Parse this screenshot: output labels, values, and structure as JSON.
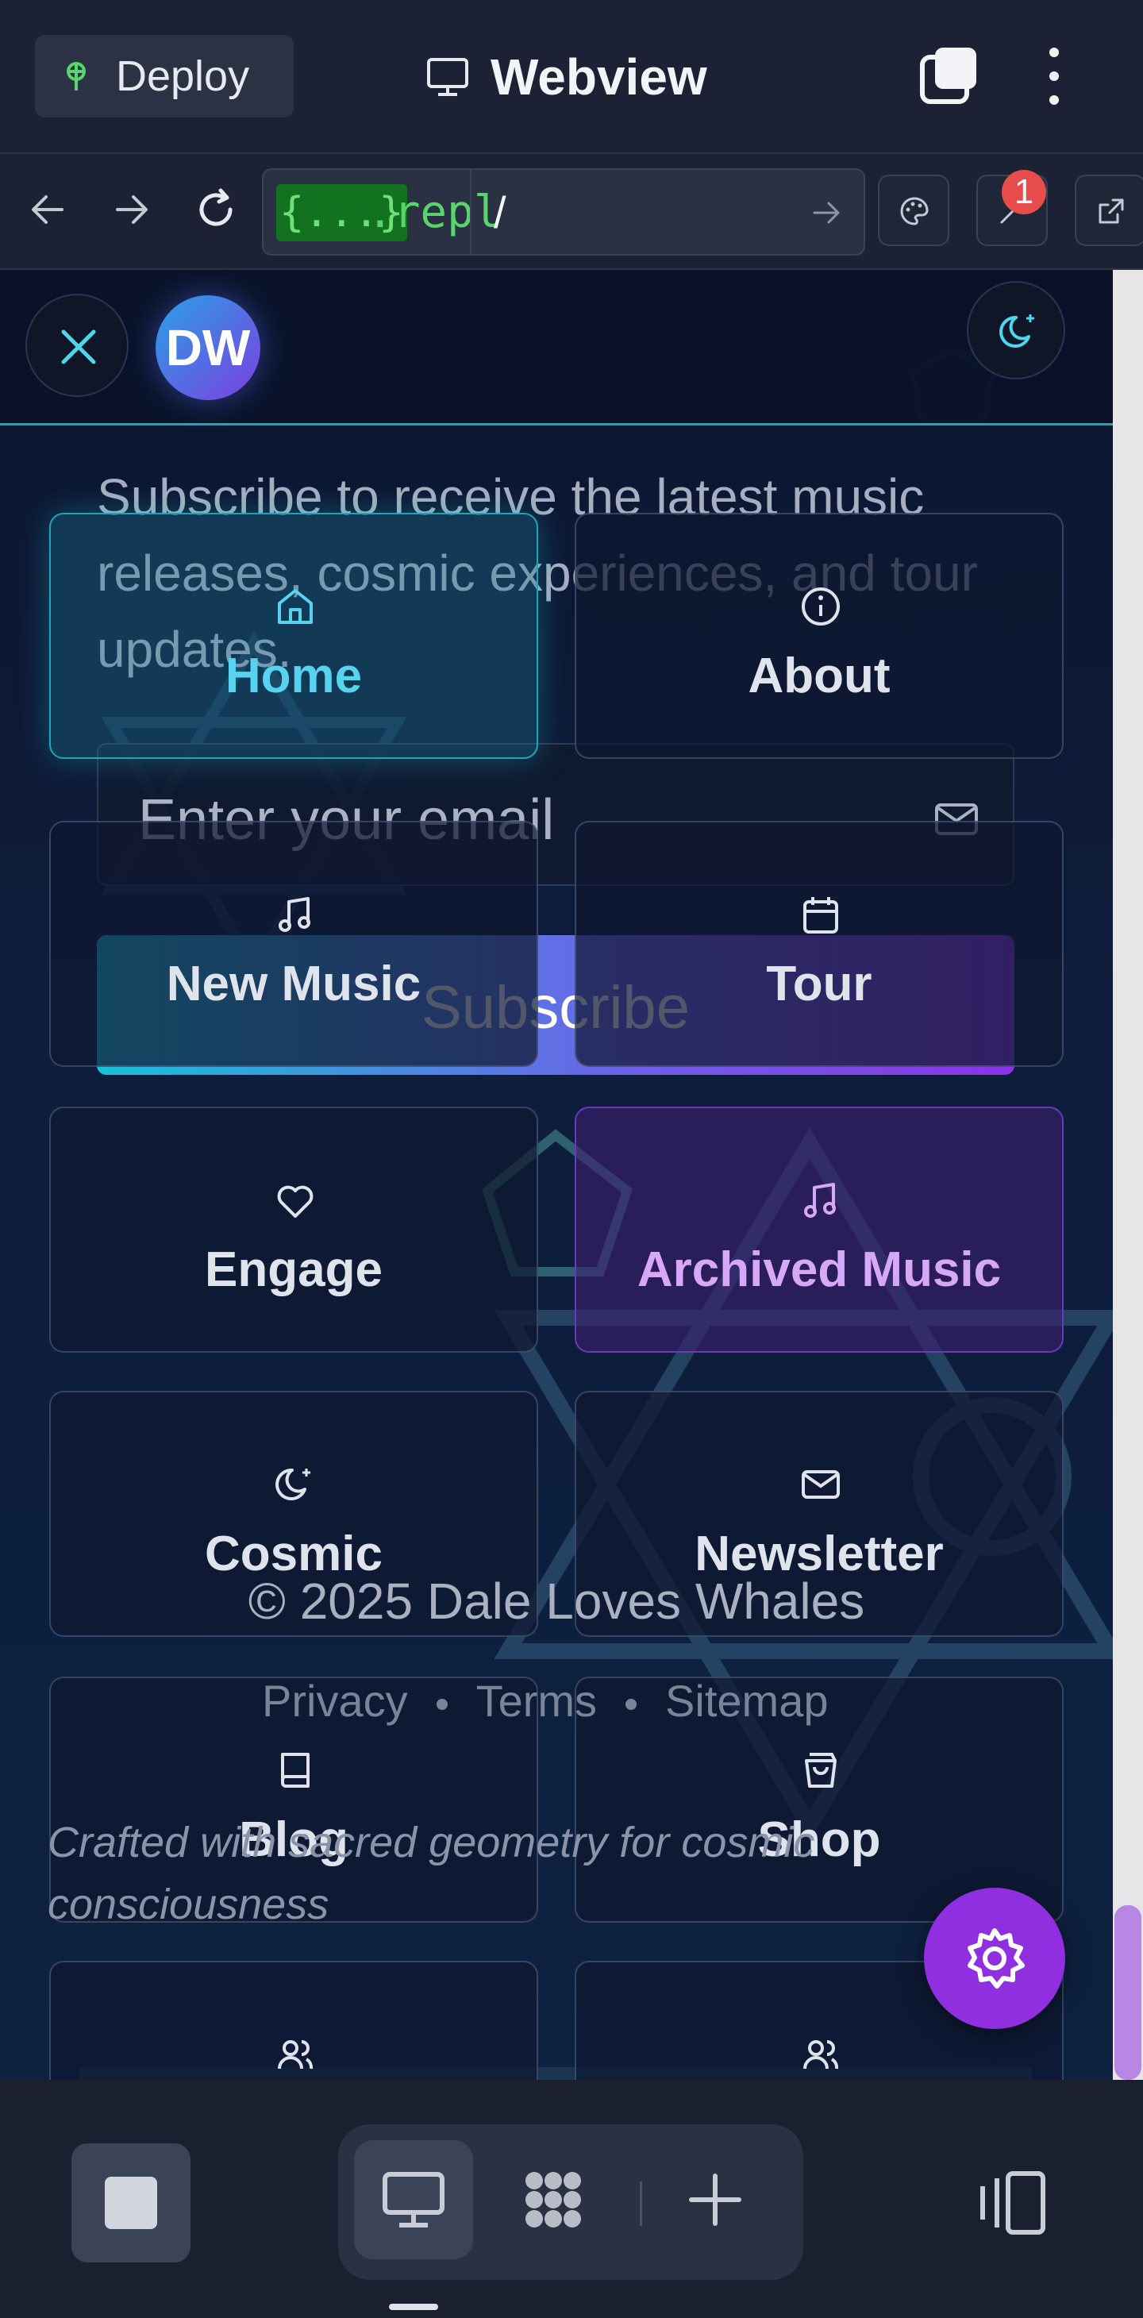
{
  "topbar": {
    "deploy_label": "Deploy",
    "title": "Webview"
  },
  "addressbar": {
    "url_badge": "{...}",
    "url_suffix": ".repl",
    "path": "/",
    "notification_count": "1"
  },
  "overlay": {
    "avatar_initials": "DW"
  },
  "newsletter": {
    "description": "Subscribe to receive the latest music releases, cosmic experiences, and tour updates.",
    "email_placeholder": "Enter your email",
    "subscribe_label": "Subscribe"
  },
  "footer": {
    "copyright": "© 2025 Dale Loves Whales",
    "links": [
      "Privacy",
      "Terms",
      "Sitemap"
    ],
    "tagline": "Crafted with sacred geometry for cosmic consciousness"
  },
  "menu": {
    "items": [
      {
        "label": "Home",
        "icon": "home-icon"
      },
      {
        "label": "About",
        "icon": "info-icon"
      },
      {
        "label": "New Music",
        "icon": "music-icon"
      },
      {
        "label": "Tour",
        "icon": "calendar-icon"
      },
      {
        "label": "Engage",
        "icon": "heart-icon"
      },
      {
        "label": "Archived Music",
        "icon": "music-icon"
      },
      {
        "label": "Cosmic",
        "icon": "moon-star-icon"
      },
      {
        "label": "Newsletter",
        "icon": "mail-icon"
      },
      {
        "label": "Blog",
        "icon": "book-icon"
      },
      {
        "label": "Shop",
        "icon": "shopping-bag-icon"
      },
      {
        "label": "",
        "icon": "users-icon"
      },
      {
        "label": "",
        "icon": "users-icon"
      }
    ]
  },
  "colors": {
    "accent_cyan": "#1fa5b6",
    "accent_purple": "#8f2fe0",
    "background": "#0c1530"
  }
}
